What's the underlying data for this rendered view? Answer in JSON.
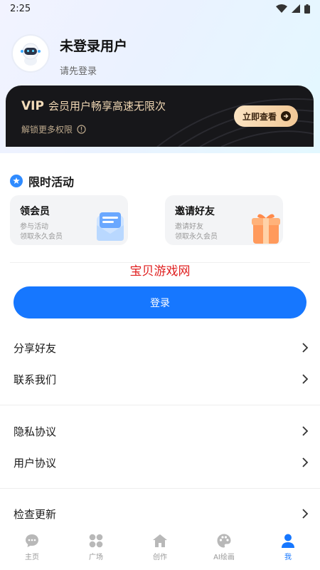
{
  "status_bar": {
    "time": "2:25"
  },
  "profile": {
    "username": "未登录用户",
    "hint": "请先登录"
  },
  "vip": {
    "badge": "VIP",
    "title": "会员用户畅享高速无限次",
    "subtitle": "解锁更多权限",
    "button": "立即查看"
  },
  "activities": {
    "title": "限时活动",
    "cards": [
      {
        "title": "领会员",
        "line1": "参与活动",
        "line2": "领取永久会员"
      },
      {
        "title": "邀请好友",
        "line1": "邀请好友",
        "line2": "领取永久会员"
      }
    ]
  },
  "watermark": "宝贝游戏网",
  "login_button": "登录",
  "menu": {
    "share": "分享好友",
    "contact": "联系我们",
    "privacy": "隐私协议",
    "user_agreement": "用户协议",
    "update": "检查更新"
  },
  "tabs": [
    {
      "label": "主页",
      "icon": "chat-bubble-icon"
    },
    {
      "label": "广场",
      "icon": "grid-icon"
    },
    {
      "label": "创作",
      "icon": "home-icon"
    },
    {
      "label": "AI绘画",
      "icon": "palette-icon"
    },
    {
      "label": "我",
      "icon": "user-icon"
    }
  ],
  "colors": {
    "primary": "#1677ff",
    "vip_dark": "#17171a",
    "vip_gold": "#efd6b3"
  }
}
